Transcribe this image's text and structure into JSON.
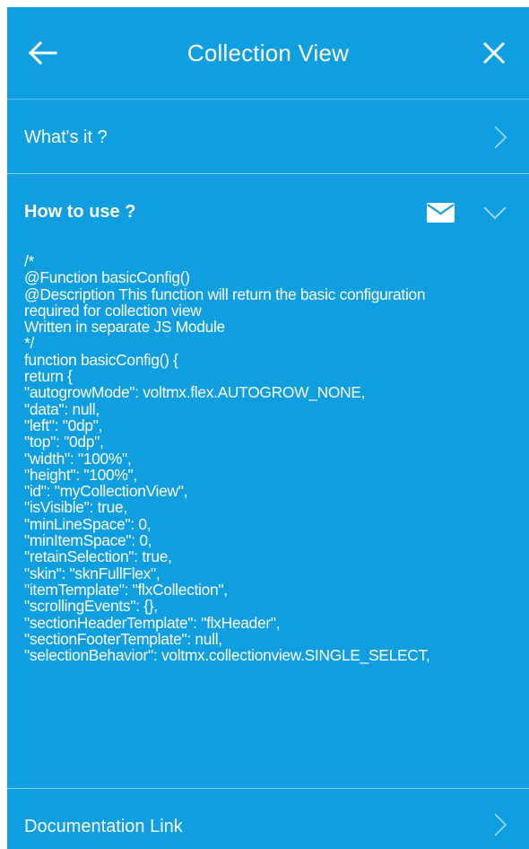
{
  "header": {
    "title": "Collection View",
    "back_icon": "arrow-left-icon",
    "close_icon": "close-icon"
  },
  "sections": {
    "whats_it": {
      "label": "What's it ?",
      "icon": "chevron-right-icon"
    },
    "how_to_use": {
      "label": "How to use ?",
      "mail_icon": "mail-icon",
      "toggle_icon": "chevron-down-icon",
      "code_lines": [
        "/*",
        "@Function basicConfig()",
        "@Description This function will return the basic configuration",
        "required for collection view",
        "Written in separate JS Module",
        "*/",
        "function basicConfig() {",
        "return {",
        "\"autogrowMode\": voltmx.flex.AUTOGROW_NONE,",
        "\"data\": null,",
        "\"left\": \"0dp\",",
        "\"top\": \"0dp\",",
        "\"width\": \"100%\",",
        "\"height\": \"100%\",",
        "\"id\": \"myCollectionView\",",
        "\"isVisible\": true,",
        "\"minLineSpace\": 0,",
        "\"minItemSpace\": 0,",
        "\"retainSelection\": true,",
        "\"skin\": \"sknFullFlex\",",
        "\"itemTemplate\": \"flxCollection\",",
        "\"scrollingEvents\": {},",
        "\"sectionHeaderTemplate\": \"flxHeader\",",
        "\"sectionFooterTemplate\": null,",
        "\"selectionBehavior\": voltmx.collectionview.SINGLE_SELECT,"
      ]
    },
    "documentation": {
      "label": "Documentation Link",
      "icon": "chevron-right-icon"
    }
  },
  "colors": {
    "background": "#0f9ee0",
    "text": "#ffffff"
  }
}
